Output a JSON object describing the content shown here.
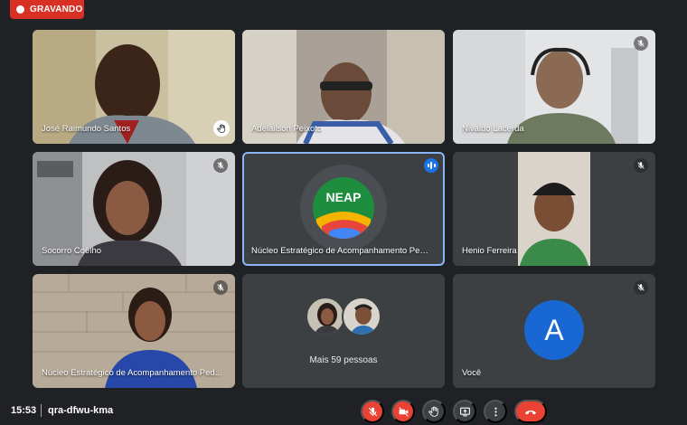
{
  "recording": {
    "label": "GRAVANDO"
  },
  "tiles": {
    "jose": {
      "name": "José Raimundo Santos"
    },
    "adelailson": {
      "name": "Adelailson Peixoto"
    },
    "nivaldo": {
      "name": "Nivaldo Lacerda"
    },
    "socorro": {
      "name": "Socorro Coêlho"
    },
    "neap": {
      "name": "Núcleo Estratégico de Acompanhamento Peda...",
      "logo_text": "NEAP"
    },
    "henio": {
      "name": "Henio Ferreira"
    },
    "neap2": {
      "name": "Núcleo Estratégico de Acompanhamento Ped..."
    },
    "others": {
      "label": "Mais 59 pessoas"
    },
    "voce": {
      "name": "Você",
      "initial": "A"
    }
  },
  "bottom_bar": {
    "time": "15:53",
    "meeting_code": "qra-dfwu-kma"
  },
  "icons": {
    "mic_off": "mic-off-icon",
    "hand": "raised-hand-icon",
    "speaking": "speaking-indicator-icon",
    "camera_off": "camera-off-icon",
    "present": "present-screen-icon",
    "more": "more-vert-icon",
    "end_call": "end-call-icon"
  },
  "colors": {
    "recording": "#d93025",
    "end_call": "#ea4335",
    "avatar": "#1967d2",
    "active_outline": "#8ab4f8",
    "background": "#202124"
  }
}
